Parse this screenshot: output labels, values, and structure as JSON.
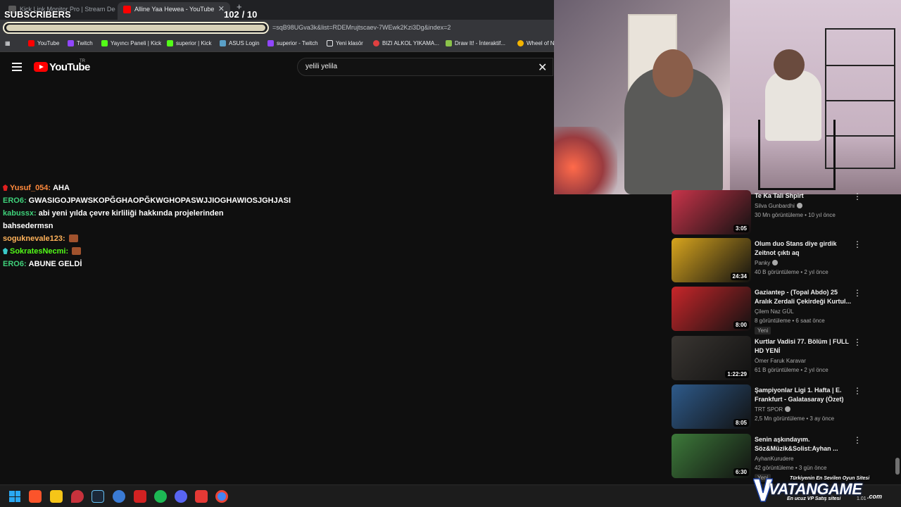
{
  "browser": {
    "tabs": [
      {
        "label": "Kick Link Monitor Pro | Stream Deck",
        "active": false
      },
      {
        "label": "Alline Yaa Hewea - YouTube",
        "active": true
      }
    ],
    "url_fragment": "=sqB98UGva3k&list=RDEMrujtscaev-7WEwk2Kzi3Dg&index=2",
    "bookmarks": [
      "YouTube",
      "Twitch",
      "Yayıncı Paneli | Kick",
      "superior | Kick",
      "ASUS Login",
      "superior - Twitch",
      "Yeni klasör",
      "BIZI ALKOL YIKAMA...",
      "Draw It! - İnteraktif...",
      "Wheel of N"
    ]
  },
  "overlay": {
    "subs_label": "SUBSCRIBERS",
    "subs_current": "102",
    "subs_goal": "/ 10"
  },
  "youtube": {
    "logo_text": "YouTube",
    "country": "TR",
    "search_value": "yelili yelila"
  },
  "chat": [
    {
      "user": "Yusuf_054:",
      "text": "AHA",
      "color": "#ff8a3d",
      "badge": "#e02020",
      "emote": false
    },
    {
      "user": "ERO6:",
      "text": "GWASIGOJPAWSKOPĞGHAOPĞKWGHOPASWJJIOGHAWIOSJGHJASI",
      "color": "#3fd17a",
      "badge": "",
      "emote": false
    },
    {
      "user": "kabussx:",
      "text": "abi yeni yılda çevre kirliliği hakkında projelerinden bahsedermsn",
      "color": "#3fd17a",
      "badge": "",
      "emote": false
    },
    {
      "user": "soguknevale123:",
      "text": "",
      "color": "#ffb25a",
      "badge": "",
      "emote": true
    },
    {
      "user": "SokratesNecmi:",
      "text": "",
      "color": "#53fc18",
      "badge": "#3ac9c9",
      "emote": true
    },
    {
      "user": "ERO6:",
      "text": "ABUNE GELDİ",
      "color": "#3fd17a",
      "badge": "",
      "emote": false
    }
  ],
  "recommendations": [
    {
      "title": "Te Ka Tali Shpirt",
      "channel": "Silva Gunbardhi",
      "verified": true,
      "meta": "30 Mn görüntüleme • 10 yıl önce",
      "duration": "3:05",
      "new": false,
      "thumb": "#c9344a"
    },
    {
      "title": "Olum duo Stans diye girdik Zeitnot çıktı aq",
      "channel": "Panky",
      "verified": true,
      "meta": "40 B görüntüleme • 2 yıl önce",
      "duration": "24:34",
      "new": false,
      "thumb": "#d8a51e"
    },
    {
      "title": "Gaziantep - (Topal Abdo) 25 Aralık Zerdali Çekirdeği Kurtul...",
      "channel": "Çilem Naz GÜL",
      "verified": false,
      "meta": "8 görüntüleme • 6 saat önce",
      "duration": "8:00",
      "new": true,
      "thumb": "#c8262a"
    },
    {
      "title": "Kurtlar Vadisi 77. Bölüm | FULL HD YENİ",
      "channel": "Ömer Faruk Karavar",
      "verified": false,
      "meta": "61 B görüntüleme • 2 yıl önce",
      "duration": "1:22:29",
      "new": false,
      "thumb": "#3a3632"
    },
    {
      "title": "Şampiyonlar Ligi 1. Hafta | E. Frankfurt - Galatasaray (Özet)",
      "channel": "TRT SPOR",
      "verified": true,
      "meta": "2,5 Mn görüntüleme • 3 ay önce",
      "duration": "8:05",
      "new": false,
      "thumb": "#2e5a8a"
    },
    {
      "title": "Senin aşkındayım. Söz&Müzik&Solist:Ayhan ...",
      "channel": "AyhanKurudere",
      "verified": false,
      "meta": "42 görüntüleme • 3 gün önce",
      "duration": "6:30",
      "new": true,
      "thumb": "#3d7a3a"
    }
  ],
  "new_label": "Yeni",
  "sponsor": {
    "tagline": "Türkiyenin En Sevilen Oyun Sitesi",
    "brand": "VATANGAME",
    "subline": "En ucuz VP Satış sitesi",
    "com": ".com",
    "version": "1.01"
  },
  "colors": {
    "accent": "#ff0000",
    "background": "#0f0f0f"
  }
}
